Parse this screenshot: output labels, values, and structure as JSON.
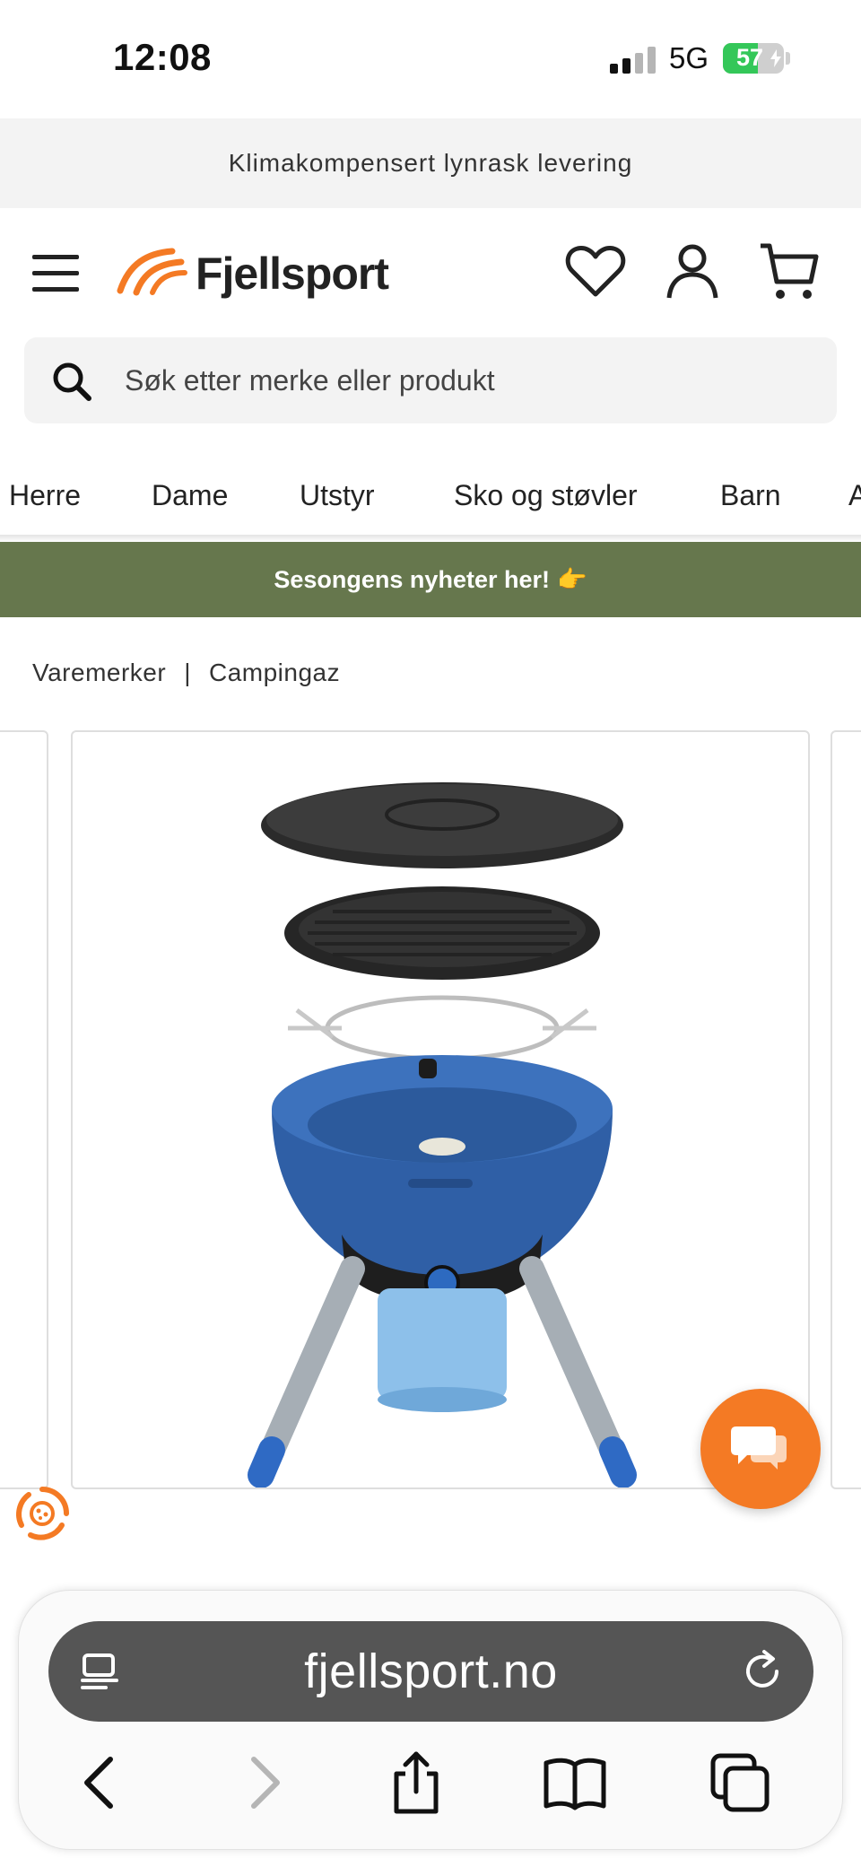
{
  "status_bar": {
    "time": "12:08",
    "network": "5G",
    "battery_level": "57",
    "battery_fraction": 0.57
  },
  "promo": {
    "text": "Klimakompensert lynrask levering"
  },
  "header": {
    "logo_text": "Fjellsport",
    "icons": [
      "menu-icon",
      "heart-icon",
      "user-icon",
      "cart-icon"
    ]
  },
  "search": {
    "placeholder": "Søk etter merke eller produkt"
  },
  "nav": {
    "items": [
      {
        "label": "Herre"
      },
      {
        "label": "Dame"
      },
      {
        "label": "Utstyr"
      },
      {
        "label": "Sko og støvler"
      },
      {
        "label": "Barn"
      },
      {
        "label": "A"
      }
    ]
  },
  "banner": {
    "text": "Sesongens nyheter her!",
    "emoji": "👉"
  },
  "breadcrumb": {
    "items": [
      "Varemerker",
      "Campingaz"
    ],
    "separator": "|"
  },
  "product": {
    "image": "campingaz-party-grill-image"
  },
  "browser": {
    "url": "fjellsport.no",
    "toolbar_icons": [
      "back-icon",
      "forward-icon",
      "share-icon",
      "bookmarks-icon",
      "tabs-icon"
    ]
  },
  "colors": {
    "brand_orange": "#f47a24",
    "banner_green": "#66774d",
    "battery_green": "#34c759",
    "url_bar": "#555555"
  }
}
